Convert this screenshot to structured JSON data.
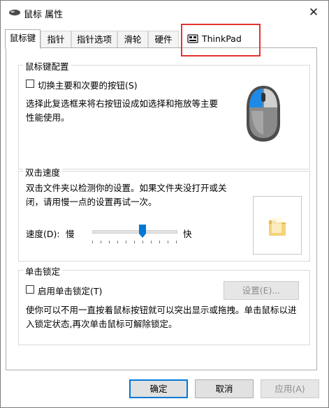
{
  "window": {
    "title": "鼠标 属性",
    "close_glyph": "✕"
  },
  "tabs": [
    {
      "label": "鼠标键",
      "active": true
    },
    {
      "label": "指针",
      "active": false
    },
    {
      "label": "指针选项",
      "active": false
    },
    {
      "label": "滑轮",
      "active": false
    },
    {
      "label": "硬件",
      "active": false
    },
    {
      "label": "ThinkPad",
      "active": false,
      "icon": "thinkpad-icon"
    }
  ],
  "button_config": {
    "title": "鼠标键配置",
    "switch_checkbox": {
      "label": "切换主要和次要的按钮(S)",
      "checked": false
    },
    "description_lines": [
      "选择此复选框来将右按钮设成如选择和拖放等主要",
      "性能使用。"
    ]
  },
  "double_click": {
    "title": "双击速度",
    "description_lines": [
      "双击文件夹以检测你的设置。如果文件夹没打开或关",
      "闭，请用慢一点的设置再试一次。"
    ],
    "speed_label": "速度(D):",
    "slow_label": "慢",
    "fast_label": "快",
    "slider_value": 0.6
  },
  "click_lock": {
    "title": "单击锁定",
    "checkbox": {
      "label": "启用单击锁定(T)",
      "checked": false
    },
    "settings_button": "设置(E)...",
    "description_lines": [
      "使你可以不用一直按着鼠标按钮就可以突出显示或拖拽。单击鼠标以进",
      "入锁定状态,再次单击鼠标可解除锁定。"
    ]
  },
  "footer": {
    "ok": "确定",
    "cancel": "取消",
    "apply": "应用(A)"
  },
  "colors": {
    "accent": "#0078d7",
    "highlight": "#e3342f",
    "mouse_blue": "#1f8ae6"
  }
}
